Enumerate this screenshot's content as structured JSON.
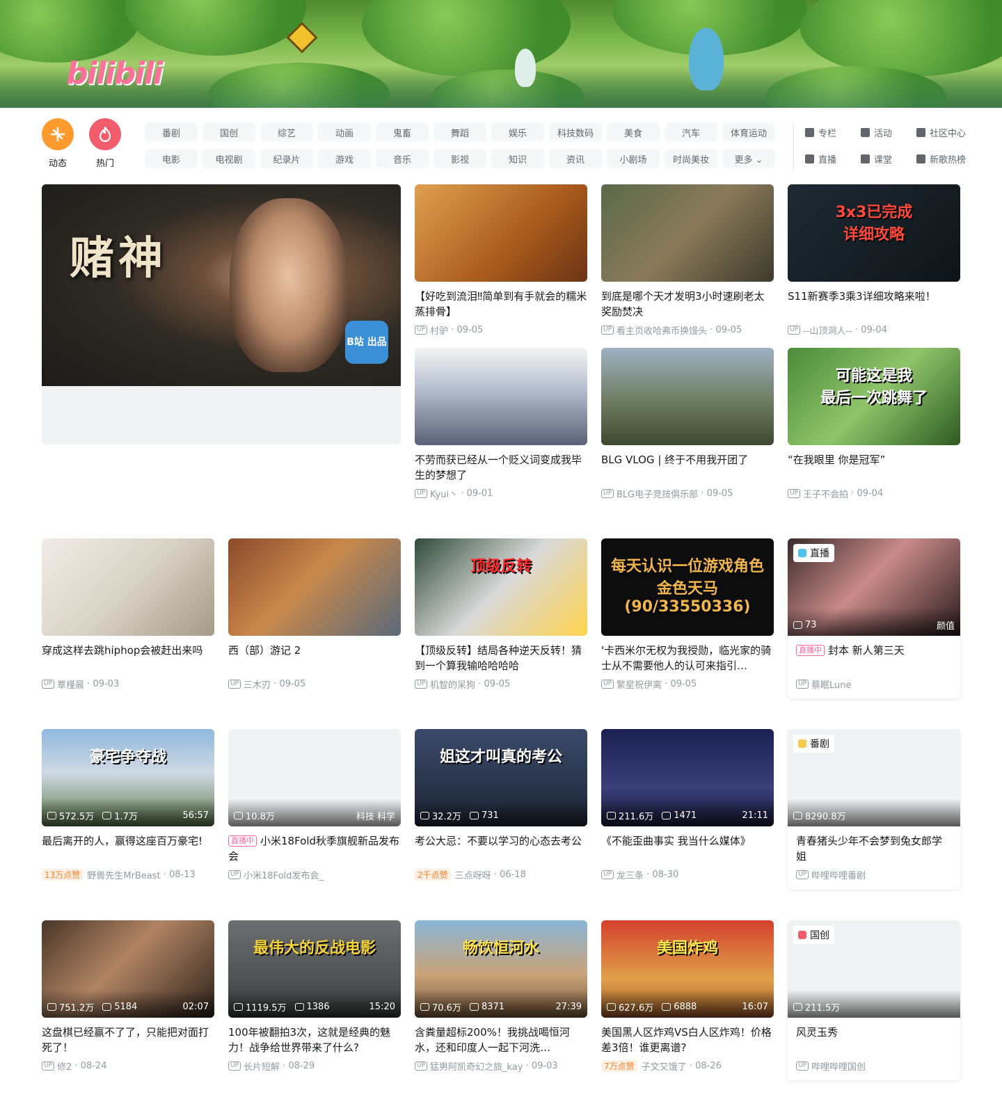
{
  "banner": {
    "logo": "bilibili"
  },
  "quick": [
    {
      "label": "动态",
      "color": "#ff9a2e",
      "icon": "dynamic-icon"
    },
    {
      "label": "热门",
      "color": "#f25d6d",
      "icon": "hot-icon"
    }
  ],
  "categories": [
    "番剧",
    "国创",
    "综艺",
    "动画",
    "鬼畜",
    "舞蹈",
    "娱乐",
    "科技数码",
    "美食",
    "汽车",
    "体育运动",
    "电影",
    "电视剧",
    "纪录片",
    "游戏",
    "音乐",
    "影视",
    "知识",
    "资讯",
    "小剧场",
    "时尚美妆",
    "更多 ⌄"
  ],
  "side_links": [
    {
      "label": "专栏",
      "icon": "column-icon"
    },
    {
      "label": "活动",
      "icon": "activity-icon"
    },
    {
      "label": "社区中心",
      "icon": "community-icon"
    },
    {
      "label": "直播",
      "icon": "live-icon"
    },
    {
      "label": "课堂",
      "icon": "classroom-icon"
    },
    {
      "label": "新歌热榜",
      "icon": "music-chart-icon"
    }
  ],
  "carousel": {
    "art_title": "赌神",
    "badge": "B站 出品"
  },
  "cards": [
    {
      "title": "【好吃到流泪‼简单到有手就会的糯米蒸排骨】",
      "up": "村驴",
      "date": "09-05",
      "bg": "linear-gradient(135deg,#e0a050,#a75a1c 60%,#6b3414)"
    },
    {
      "title": "到底是哪个天才发明3小时速刷老太奖励焚决",
      "up": "看主页收哈弗币换馒头",
      "date": "09-05",
      "bg": "linear-gradient(135deg,#5a6a4a,#8a7a5a 50%,#3d3a2c)"
    },
    {
      "title": "S11新赛季3乘3详细攻略来啦！",
      "up": "--山顶洞人--",
      "date": "09-04",
      "bg": "linear-gradient(135deg,#1f2a33,#0e1419)",
      "art": "3x3已完成\n详细攻略",
      "art_color": "#ff4a3a"
    },
    {
      "title": "不劳而获已经从一个贬义词变成我毕生的梦想了",
      "up": "Kyui丶",
      "date": "09-01",
      "bg": "linear-gradient(180deg,#f4f4f4 0%,#b9c2d1 40%,#5a6275 100%)"
    },
    {
      "title": "BLG VLOG | 终于不用我开团了",
      "up": "BLG电子竞技俱乐部",
      "date": "09-05",
      "bg": "linear-gradient(180deg,#9fb1c3 0%,#6d7c60 55%,#3f4830 100%)"
    },
    {
      "title": "“在我眼里 你是冠军”",
      "up": "王子不会拍",
      "date": "09-04",
      "bg": "linear-gradient(135deg,#4c8a3a,#8fc46a 50%,#2c5a22)",
      "art": "可能这是我\n最后一次跳舞了",
      "art_color": "#ffffff"
    },
    {
      "title": "穿成这样去跳hiphop会被赶出来吗",
      "up": "覃槿晨",
      "date": "09-03",
      "bg": "linear-gradient(135deg,#f0ece6,#d9d2c6 50%,#a59a88)"
    },
    {
      "title": "西（部）游记 2",
      "up": "三木刃",
      "date": "09-05",
      "bg": "linear-gradient(135deg,#8a4a2c,#c9884a 45%,#5a6a7a)"
    },
    {
      "title": "【顶级反转】结局各种逆天反转！猜到一个算我输哈哈哈哈",
      "up": "机智的呆狗",
      "date": "09-05",
      "bg": "linear-gradient(135deg,#2f4a3a,#d9d9d9 50%,#ffd34d)",
      "art": "顶级反转",
      "art_color": "#ff2a2a"
    },
    {
      "title": "'卡西米尔无权为我授勋，临光家的骑士从不需要他人的认可来指引…",
      "up": "繁星祝伊离",
      "date": "09-05",
      "bg": "#0d0d0d",
      "art": "每天认识一位游戏角色\n金色天马\n(90/33550336)",
      "art_color": "#f2b64d"
    },
    {
      "title": "最后离开的人，赢得这座百万豪宅!",
      "up": "野兽先生MrBeast",
      "date": "08-13",
      "like": "13万点赞",
      "views": "572.5万",
      "danmaku": "1.7万",
      "duration": "56:57",
      "bg": "linear-gradient(180deg,#8fb8dc 0%,#cfd9e4 45%,#5d7a4a 100%)",
      "art": "豪宅争夺战",
      "art_color": "#ffffff"
    },
    {
      "title": "小米18Fold秋季旗舰新品发布会",
      "up": "小米18Fold发布会_",
      "live": "直播中",
      "views": "10.8万",
      "area": "科技 科学",
      "bg": "#f1f2f3"
    },
    {
      "title": "考公大忌：不要以学习的心态去考公",
      "up": "三点呀呀",
      "date": "06-18",
      "like": "2千点赞",
      "views": "32.2万",
      "danmaku": "731",
      "bg": "linear-gradient(180deg,#3a4a6a,#1e2636)",
      "art": "姐这才叫真的考公",
      "art_color": "#ffffff"
    },
    {
      "title": "《不能歪曲事实 我当什么媒体》",
      "up": "龙三条",
      "date": "08-30",
      "views": "211.6万",
      "danmaku": "1471",
      "duration": "21:11",
      "bg": "linear-gradient(180deg,#1b2150,#3a3f7a 60%,#1a1d3a)"
    },
    {
      "title": "这盘棋已经赢不了了，只能把对面打死了！",
      "up": "修2",
      "date": "08-24",
      "views": "751.2万",
      "danmaku": "5184",
      "duration": "02:07",
      "bg": "linear-gradient(135deg,#4a3628,#b08464 45%,#2e221a)"
    },
    {
      "title": "100年被翻拍3次，这就是经典的魅力！战争给世界带来了什么?",
      "up": "长片短解",
      "date": "08-29",
      "views": "1119.5万",
      "danmaku": "1386",
      "duration": "15:20",
      "bg": "linear-gradient(180deg,#6c7070,#3a3e3e)",
      "art": "最伟大的反战电影",
      "art_color": "#f5d23a"
    },
    {
      "title": "含粪量超标200%！我挑战喝恒河水，还和印度人一起下河洗…",
      "up": "猛男阿凯奇幻之旅_kay",
      "date": "09-03",
      "views": "70.6万",
      "danmaku": "8371",
      "duration": "27:39",
      "bg": "linear-gradient(180deg,#8ab6d6 0%,#c9a37a 55%,#7a5a3a 100%)",
      "art": "畅饮恒河水",
      "art_color": "#ffe14d"
    },
    {
      "title": "美国黑人区炸鸡VS白人区炸鸡！价格差3倍！谁更离谱?",
      "up": "子文又饿了",
      "date": "08-26",
      "like": "7万点赞",
      "views": "627.6万",
      "danmaku": "6888",
      "duration": "16:07",
      "bg": "linear-gradient(180deg,#d4402c 0%,#e0a04a 60%,#9a5a2a 100%)",
      "art": "美国炸鸡",
      "art_color": "#ffe84d"
    }
  ],
  "specials": [
    {
      "tag": "直播",
      "tag_color": "#4ec2e8",
      "title": "封本 新人第三天",
      "live": "直播中",
      "up": "蔡眠Lune",
      "views": "73",
      "area": "颜值",
      "bg": "linear-gradient(135deg,#3a2a2a,#c98a8a 45%,#2a1c1c)"
    },
    {
      "tag": "番剧",
      "tag_color": "#f5c94a",
      "title": "青春猪头少年不会梦到兔女郎学姐",
      "up": "哔哩哔哩番剧",
      "views": "8290.8万",
      "bg": "#f1f2f3"
    },
    {
      "tag": "国创",
      "tag_color": "#f25d6d",
      "title": "风灵玉秀",
      "up": "哔哩哔哩国创",
      "views": "211.5万",
      "bg": "#f1f2f3"
    }
  ]
}
